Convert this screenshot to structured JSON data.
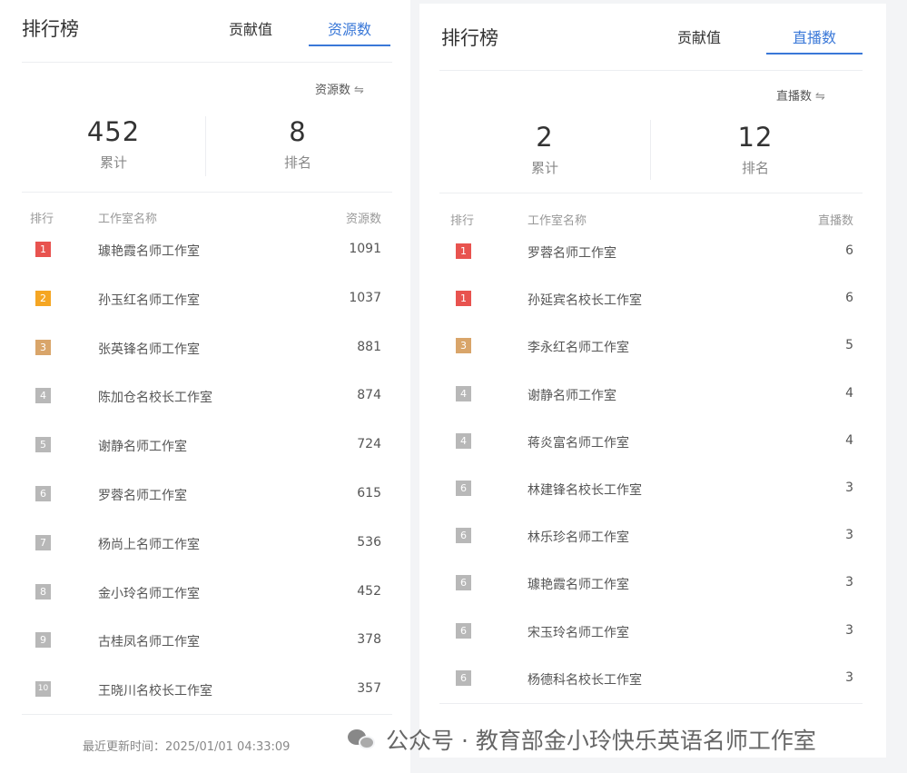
{
  "colors": {
    "accent": "#3a78d8",
    "rank1": "#e8534f",
    "rank2": "#f5a623",
    "rank3": "#d9a56a",
    "rankOther": "#b8b8b8"
  },
  "left": {
    "title": "排行榜",
    "tabs": [
      "贡献值",
      "资源数"
    ],
    "active_tab": 1,
    "sort_label": "资源数",
    "sort_icon": "⇋",
    "stats": [
      {
        "value": "452",
        "label": "累计"
      },
      {
        "value": "8",
        "label": "排名"
      }
    ],
    "columns": [
      "排行",
      "工作室名称",
      "资源数"
    ],
    "rows": [
      {
        "rank": "1",
        "tier": "rank1",
        "name": "璩艳霞名师工作室",
        "value": "1091"
      },
      {
        "rank": "2",
        "tier": "rank2",
        "name": "孙玉红名师工作室",
        "value": "1037"
      },
      {
        "rank": "3",
        "tier": "rank3",
        "name": "张英锋名师工作室",
        "value": "881"
      },
      {
        "rank": "4",
        "tier": "rankOther",
        "name": "陈加仓名校长工作室",
        "value": "874"
      },
      {
        "rank": "5",
        "tier": "rankOther",
        "name": "谢静名师工作室",
        "value": "724"
      },
      {
        "rank": "6",
        "tier": "rankOther",
        "name": "罗蓉名师工作室",
        "value": "615"
      },
      {
        "rank": "7",
        "tier": "rankOther",
        "name": "杨尚上名师工作室",
        "value": "536"
      },
      {
        "rank": "8",
        "tier": "rankOther",
        "name": "金小玲名师工作室",
        "value": "452"
      },
      {
        "rank": "9",
        "tier": "rankOther",
        "name": "古桂凤名师工作室",
        "value": "378"
      },
      {
        "rank": "10",
        "tier": "rankOther",
        "name": "王晓川名校长工作室",
        "value": "357"
      }
    ],
    "footer": "最近更新时间：2025/01/01 04:33:09"
  },
  "right": {
    "title": "排行榜",
    "tabs": [
      "贡献值",
      "直播数"
    ],
    "active_tab": 1,
    "sort_label": "直播数",
    "sort_icon": "⇋",
    "stats": [
      {
        "value": "2",
        "label": "累计"
      },
      {
        "value": "12",
        "label": "排名"
      }
    ],
    "columns": [
      "排行",
      "工作室名称",
      "直播数"
    ],
    "rows": [
      {
        "rank": "1",
        "tier": "rank1",
        "name": "罗蓉名师工作室",
        "value": "6"
      },
      {
        "rank": "1",
        "tier": "rank1",
        "name": "孙延宾名校长工作室",
        "value": "6"
      },
      {
        "rank": "3",
        "tier": "rank3",
        "name": "李永红名师工作室",
        "value": "5"
      },
      {
        "rank": "4",
        "tier": "rankOther",
        "name": "谢静名师工作室",
        "value": "4"
      },
      {
        "rank": "4",
        "tier": "rankOther",
        "name": "蒋炎富名师工作室",
        "value": "4"
      },
      {
        "rank": "6",
        "tier": "rankOther",
        "name": "林建锋名校长工作室",
        "value": "3"
      },
      {
        "rank": "6",
        "tier": "rankOther",
        "name": "林乐珍名师工作室",
        "value": "3"
      },
      {
        "rank": "6",
        "tier": "rankOther",
        "name": "璩艳霞名师工作室",
        "value": "3"
      },
      {
        "rank": "6",
        "tier": "rankOther",
        "name": "宋玉玲名师工作室",
        "value": "3"
      },
      {
        "rank": "6",
        "tier": "rankOther",
        "name": "杨德科名校长工作室",
        "value": "3"
      }
    ]
  },
  "watermark": "公众号 · 教育部金小玲快乐英语名师工作室"
}
